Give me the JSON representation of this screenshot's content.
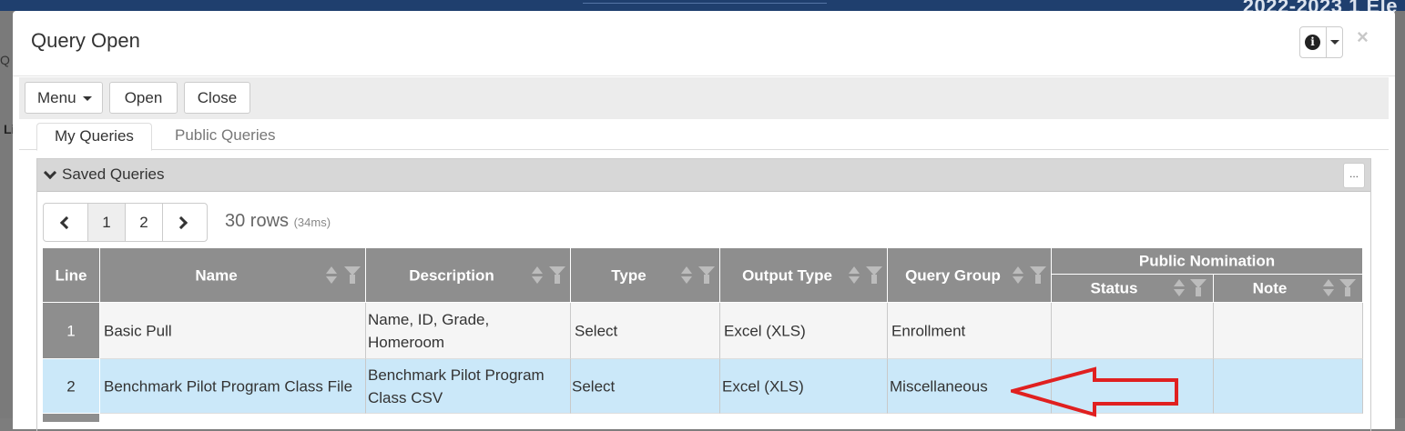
{
  "background": {
    "app_title": "2022-2023 1 Ele",
    "left_fragment": "Q",
    "left_label": "Li"
  },
  "modal": {
    "title": "Query Open",
    "close_symbol": "×",
    "info_glyph": "i"
  },
  "toolbar": {
    "menu_label": "Menu",
    "open_label": "Open",
    "close_label": "Close"
  },
  "tabs": [
    {
      "label": "My Queries",
      "active": true
    },
    {
      "label": "Public Queries",
      "active": false
    }
  ],
  "panel": {
    "title": "Saved Queries",
    "more_label": "..."
  },
  "pager": {
    "pages": [
      "1",
      "2"
    ],
    "current_page": "1",
    "rows_text": "30 rows",
    "timing_text": "(34ms)"
  },
  "table": {
    "headers": {
      "line": "Line",
      "name": "Name",
      "description": "Description",
      "type": "Type",
      "output_type": "Output Type",
      "query_group": "Query Group",
      "public_nomination": "Public Nomination",
      "status": "Status",
      "note": "Note"
    },
    "rows": [
      {
        "line": "1",
        "name": "Basic Pull",
        "description": "Name, ID, Grade, Homeroom",
        "type": "Select",
        "output_type": "Excel (XLS)",
        "query_group": "Enrollment",
        "status": "",
        "note": "",
        "selected": false
      },
      {
        "line": "2",
        "name": "Benchmark Pilot Program Class File",
        "description": "Benchmark Pilot Program Class CSV",
        "type": "Select",
        "output_type": "Excel (XLS)",
        "query_group": "Miscellaneous",
        "status": "",
        "note": "",
        "selected": true
      }
    ]
  },
  "colors": {
    "header_bg": "#8e8e8e",
    "selected_row": "#cbe8f9",
    "annotation_arrow": "#e02020"
  }
}
